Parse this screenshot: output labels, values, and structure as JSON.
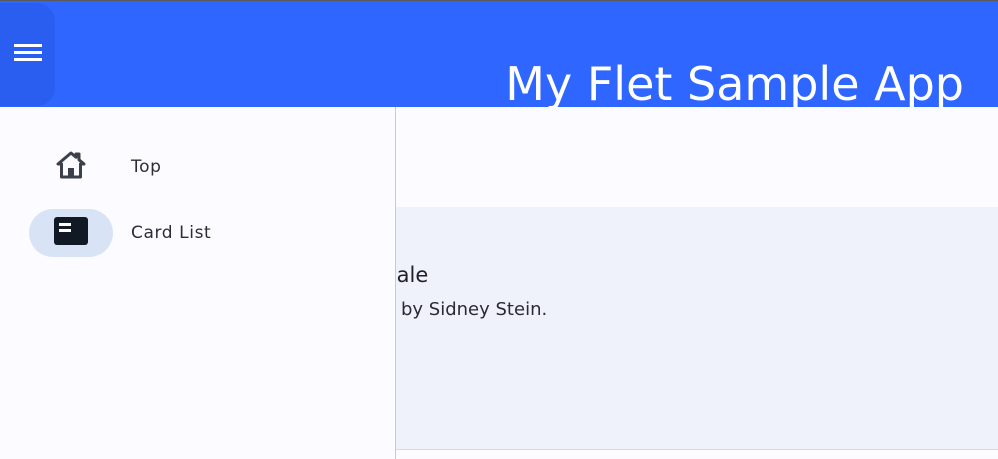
{
  "appbar": {
    "title": "My Flet Sample App",
    "menu_icon": "hamburger-menu-icon",
    "background": "#2e66ff"
  },
  "drawer": {
    "items": [
      {
        "label": "Top",
        "icon": "home-icon",
        "selected": false
      },
      {
        "label": "Card List",
        "icon": "card-list-icon",
        "selected": true
      }
    ],
    "selected_indicator_color": "#d8e3f5"
  },
  "content": {
    "card": {
      "title_visible": "ngale",
      "subtitle_visible": "ics by Sidney Stein."
    }
  }
}
